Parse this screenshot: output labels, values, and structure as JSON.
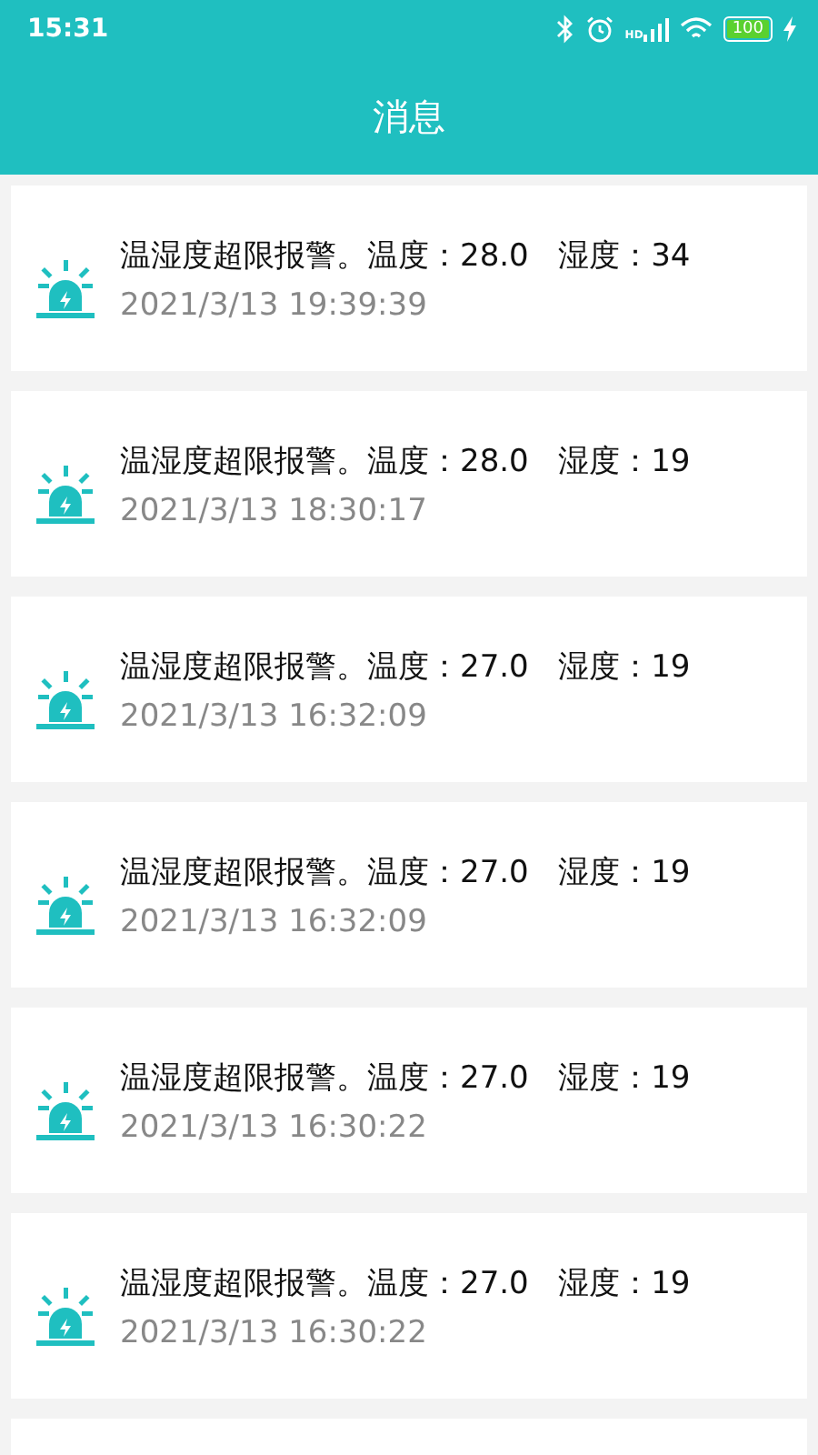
{
  "status_bar": {
    "time": "15:31",
    "signal_label": "HD",
    "battery": "100"
  },
  "header": {
    "title": "消息"
  },
  "messages": [
    {
      "text": "温湿度超限报警。温度：28.0   湿度：34",
      "time": "2021/3/13 19:39:39"
    },
    {
      "text": "温湿度超限报警。温度：28.0   湿度：19",
      "time": "2021/3/13 18:30:17"
    },
    {
      "text": "温湿度超限报警。温度：27.0   湿度：19",
      "time": "2021/3/13 16:32:09"
    },
    {
      "text": "温湿度超限报警。温度：27.0   湿度：19",
      "time": "2021/3/13 16:32:09"
    },
    {
      "text": "温湿度超限报警。温度：27.0   湿度：19",
      "time": "2021/3/13 16:30:22"
    },
    {
      "text": "温湿度超限报警。温度：27.0   湿度：19",
      "time": "2021/3/13 16:30:22"
    }
  ]
}
